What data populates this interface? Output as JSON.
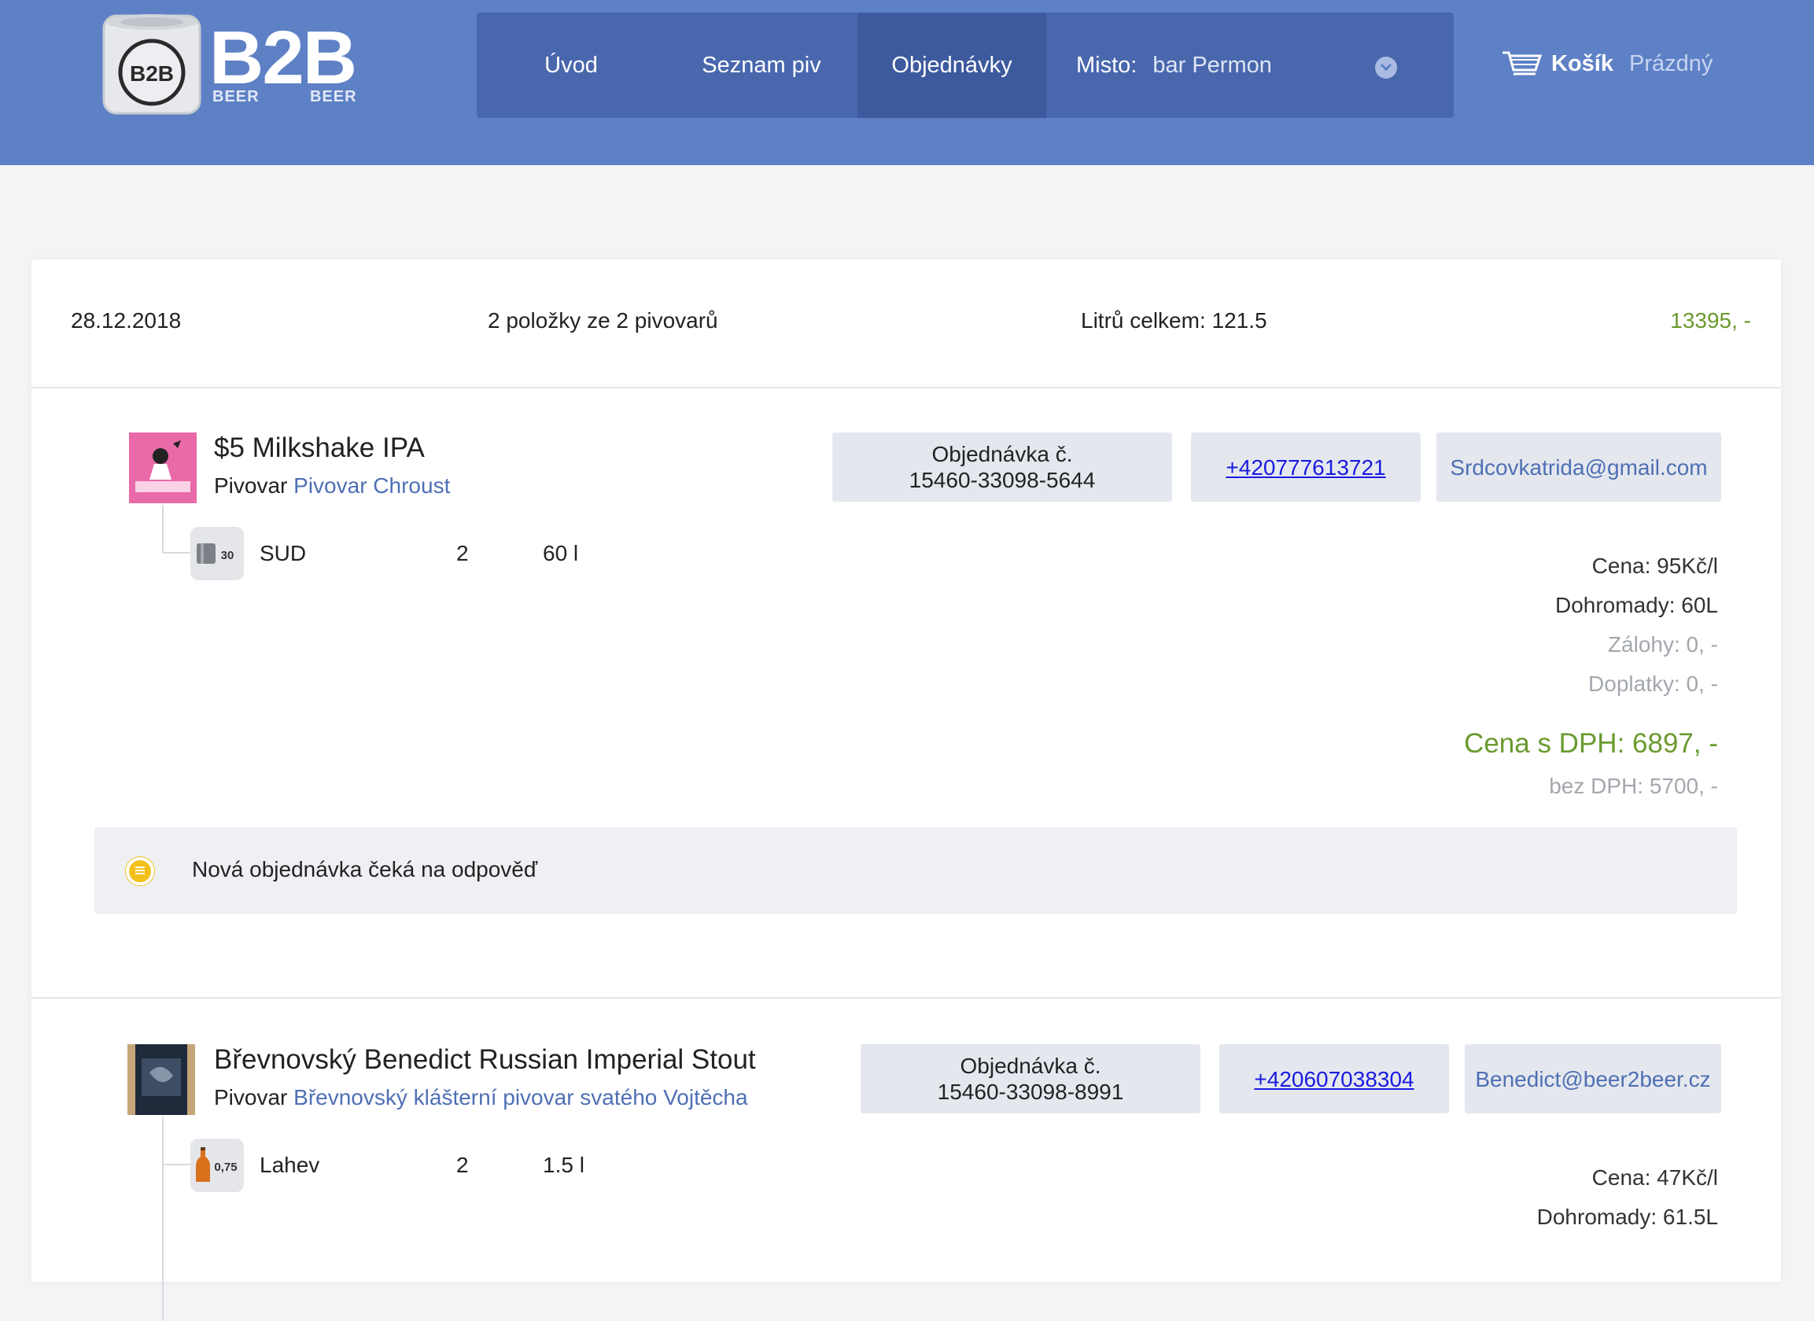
{
  "header": {
    "logo_text": "B2B",
    "logo_sub_left": "BEER",
    "logo_sub_right": "BEER",
    "logo_keg_text": "B2B",
    "nav": [
      {
        "label": "Úvod",
        "active": false
      },
      {
        "label": "Seznam piv",
        "active": false
      },
      {
        "label": "Objednávky",
        "active": true
      }
    ],
    "place_label": "Misto:",
    "place_value": "bar Permon",
    "cart_label": "Košík",
    "cart_status": "Prázdný"
  },
  "summary": {
    "date": "28.12.2018",
    "items": "2 položky ze 2 pivovarů",
    "liters": "Litrů celkem: 121.5",
    "total": "13395, -"
  },
  "orders": [
    {
      "product": "$5 Milkshake IPA",
      "brewery_prefix": "Pivovar",
      "brewery": "Pivovar Chroust",
      "order_label": "Objednávka č.",
      "order_number": "15460-33098-5644",
      "phone": "+420777613721",
      "email": "Srdcovkatrida@gmail.com",
      "package": {
        "icon_text": "30",
        "type": "SUD",
        "count": "2",
        "volume": "60 l"
      },
      "price": "Cena: 95Kč/l",
      "together": "Dohromady: 60L",
      "deposits": "Zálohy: 0, -",
      "surcharges": "Doplatky: 0, -",
      "price_vat": "Cena s DPH: 6897, -",
      "price_novat": "bez DPH: 5700, -",
      "status": "Nová objednávka čeká na odpověď"
    },
    {
      "product": "Břevnovský Benedict Russian Imperial Stout",
      "brewery_prefix": "Pivovar",
      "brewery": "Břevnovský klášterní pivovar svatého Vojtěcha",
      "order_label": "Objednávka č.",
      "order_number": "15460-33098-8991",
      "phone": "+420607038304",
      "email": "Benedict@beer2beer.cz",
      "package": {
        "icon_text": "0,75",
        "type": "Lahev",
        "count": "2",
        "volume": "1.5 l"
      },
      "price": "Cena: 47Kč/l",
      "together": "Dohromady: 61.5L"
    }
  ],
  "colors": {
    "header_bg": "#5e81c6",
    "nav_bg": "#4967ad",
    "nav_active": "#3e5a9e",
    "price_green": "#6a9a2e",
    "link_blue": "#4f6fb5",
    "status_yellow": "#f2c11a"
  }
}
